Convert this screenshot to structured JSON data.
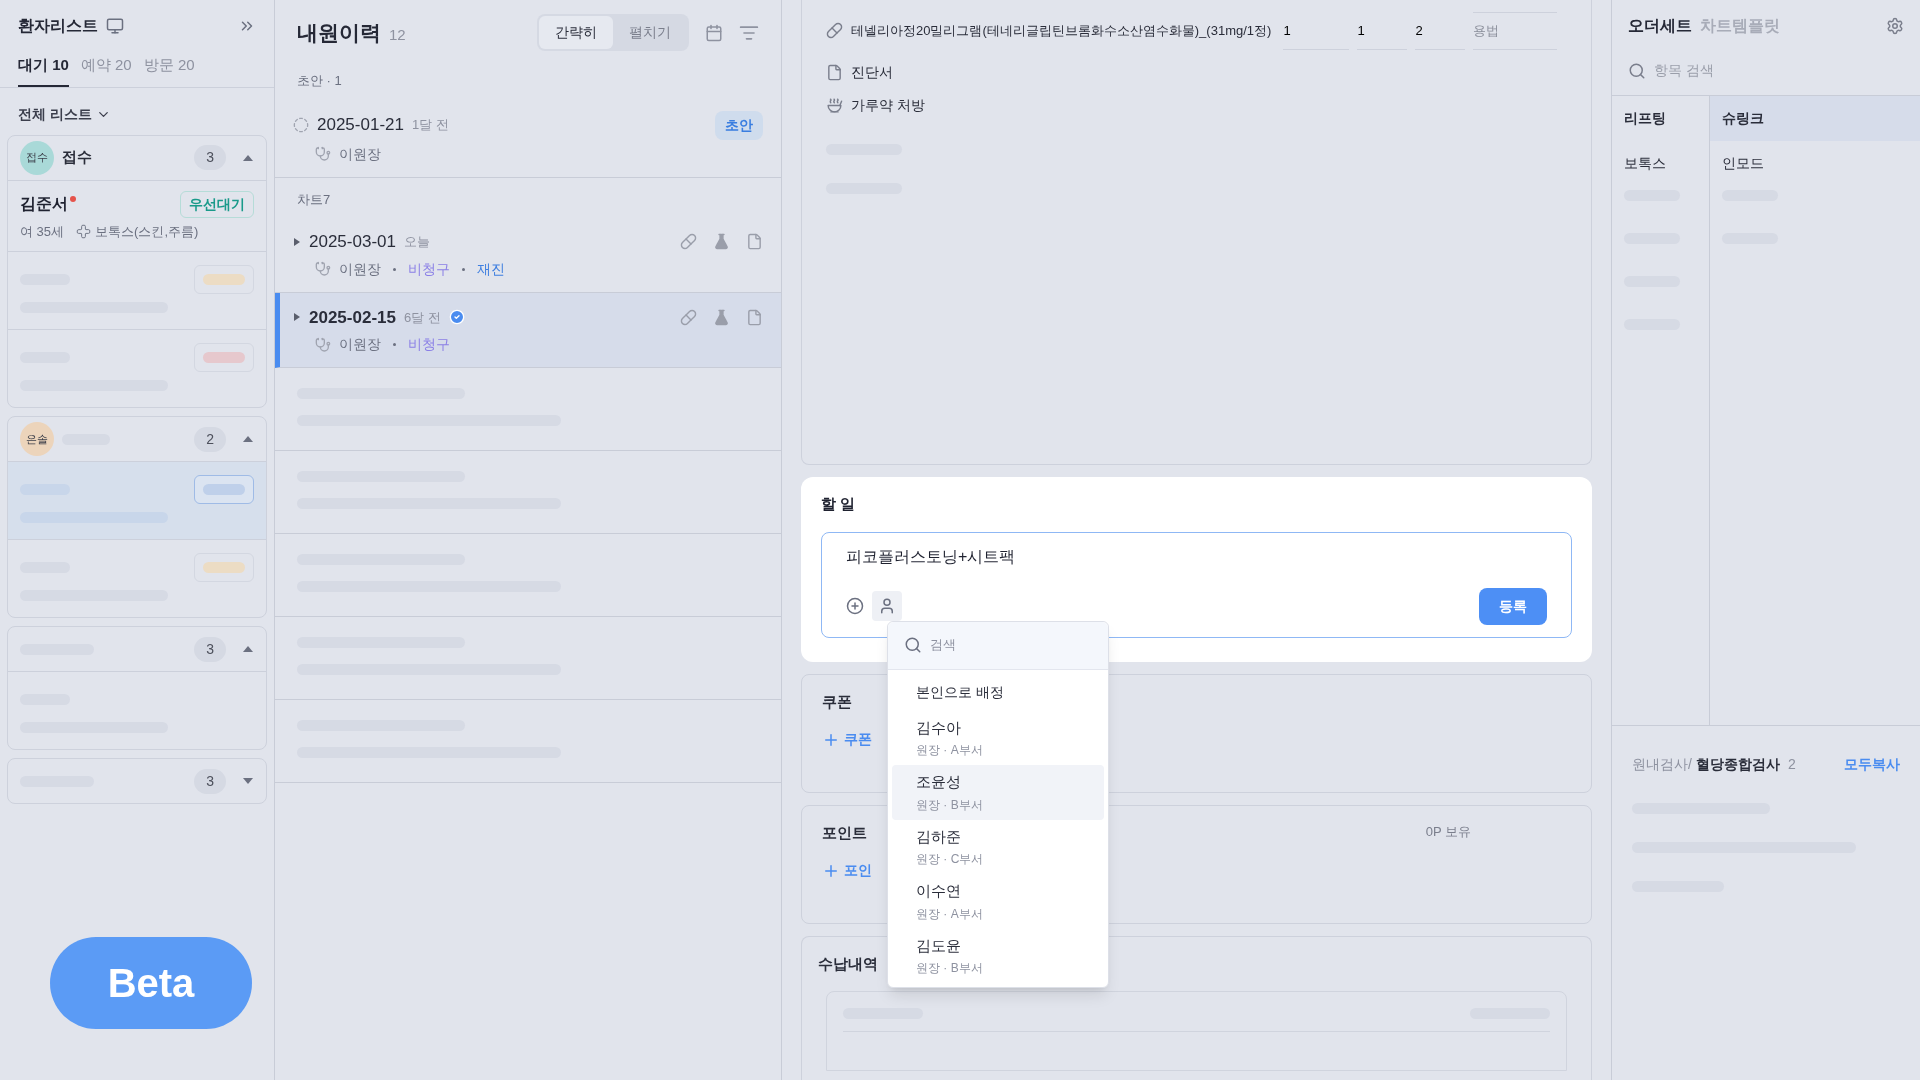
{
  "patient_list": {
    "title": "환자리스트",
    "tabs": [
      {
        "label": "대기 10",
        "selected": true
      },
      {
        "label": "예약 20",
        "selected": false
      },
      {
        "label": "방문 20",
        "selected": false
      }
    ],
    "filter": "전체 리스트",
    "groups": [
      {
        "badge": "접수",
        "color": "#a9d9d8",
        "label": "접수",
        "count": "3",
        "expanded": true,
        "rows": [
          {
            "kind": "patient",
            "name": "김준서",
            "alert": true,
            "tag": "우선대기",
            "info": "여 35세",
            "treatment": "보톡스(스킨,주름)"
          },
          {
            "kind": "placeholder",
            "color": "#ecdcc4",
            "selected": false
          },
          {
            "kind": "placeholder",
            "color": "#e6c8cd",
            "selected": false
          }
        ]
      },
      {
        "badge": "은솔",
        "color": "#ecd4bb",
        "count": "2",
        "expanded": true,
        "rows": [
          {
            "kind": "placeholder",
            "color": "#bfd0ea",
            "selected": true
          },
          {
            "kind": "placeholder",
            "color": "#ecdcc4",
            "selected": false
          }
        ]
      },
      {
        "count": "3",
        "expanded": true,
        "rows": [
          {
            "kind": "placeholder",
            "selected": false
          }
        ]
      },
      {
        "count": "3",
        "expanded": false
      }
    ]
  },
  "beta_button": "Beta",
  "visit_history": {
    "title": "내원이력",
    "count": "12",
    "view_modes": [
      {
        "label": "간략히",
        "selected": true
      },
      {
        "label": "펼치기",
        "selected": false
      }
    ],
    "sections": [
      {
        "label": "초안 · 1",
        "visits": [
          {
            "kind": "draft",
            "date": "2025-01-21",
            "ago": "1달 전",
            "doctor": "이원장",
            "badge": "초안",
            "selected": false
          }
        ]
      },
      {
        "label": "차트7",
        "visits": [
          {
            "kind": "chart",
            "date": "2025-03-01",
            "ago": "오늘",
            "doctor": "이원장",
            "selected": false,
            "verified": false,
            "tags": [
              {
                "text": "비청구",
                "color": "#8a7fe6"
              },
              {
                "text": "재진",
                "color": "#3f7fe0"
              }
            ]
          },
          {
            "kind": "chart",
            "date": "2025-02-15",
            "ago": "6달 전",
            "doctor": "이원장",
            "selected": true,
            "verified": true,
            "tags": [
              {
                "text": "비청구",
                "color": "#8a7fe6"
              }
            ]
          }
        ]
      }
    ]
  },
  "orders": {
    "medication": {
      "name": "테넬리아정20밀리그램(테네리글립틴브롬화수소산염수화물)_(31mg/1정)",
      "values": [
        "1",
        "1",
        "2"
      ],
      "usage_placeholder": "용법"
    },
    "items": [
      {
        "kind": "document",
        "label": "진단서"
      },
      {
        "kind": "powder",
        "label": "가루약 처방"
      }
    ]
  },
  "task": {
    "title": "할 일",
    "text": "피코플러스토닝+시트팩",
    "submit": "등록",
    "assignee_menu": {
      "search_placeholder": "검색",
      "self_assign": "본인으로 배정",
      "people": [
        {
          "name": "김수아",
          "role": "원장 · A부서",
          "selected": false
        },
        {
          "name": "조윤성",
          "role": "원장 · B부서",
          "selected": true
        },
        {
          "name": "김하준",
          "role": "원장 · C부서",
          "selected": false
        },
        {
          "name": "이수연",
          "role": "원장 · A부서",
          "selected": false
        },
        {
          "name": "김도윤",
          "role": "원장 · B부서",
          "selected": false
        }
      ]
    }
  },
  "coupon": {
    "title": "쿠폰",
    "add_link": "쿠폰"
  },
  "points": {
    "title": "포인트",
    "add_link": "포인",
    "balance": "0P 보유"
  },
  "payments": {
    "title": "수납내역"
  },
  "order_sets": {
    "tabs": [
      {
        "label": "오더세트",
        "selected": true
      },
      {
        "label": "차트템플릿",
        "selected": false
      }
    ],
    "search_placeholder": "항목 검색",
    "categories": [
      {
        "label": "리프팅",
        "selected": true
      },
      {
        "label": "보톡스",
        "selected": false
      }
    ],
    "items": [
      {
        "label": "슈링크",
        "selected": true
      },
      {
        "label": "인모드",
        "selected": false
      }
    ],
    "lab": {
      "path": "원내검사/",
      "name": "혈당종합검사",
      "count": "2",
      "copy_all": "모두복사"
    }
  }
}
